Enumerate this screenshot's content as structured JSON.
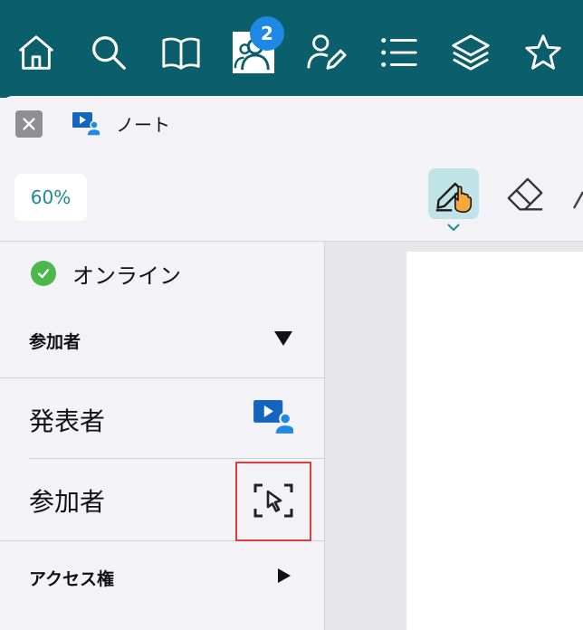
{
  "toolbar": {
    "badge_count": "2",
    "icons": [
      "home-icon",
      "search-icon",
      "book-icon",
      "participants-icon",
      "user-edit-icon",
      "list-icon",
      "layers-icon",
      "star-icon"
    ],
    "background": "#0b5f6b",
    "badge_color": "#1e88e5"
  },
  "tab": {
    "title": "ノート"
  },
  "zoom": {
    "value": "60%"
  },
  "tools": {
    "active": "pen-hand-tool",
    "active_bg": "#bfe3e6"
  },
  "sidebar": {
    "status_label": "オンライン",
    "status_color": "#4cb84c",
    "participants_section": "参加者",
    "presenter_label": "発表者",
    "participant_label": "参加者",
    "access_section": "アクセス権"
  },
  "highlight_color": "#d64040"
}
